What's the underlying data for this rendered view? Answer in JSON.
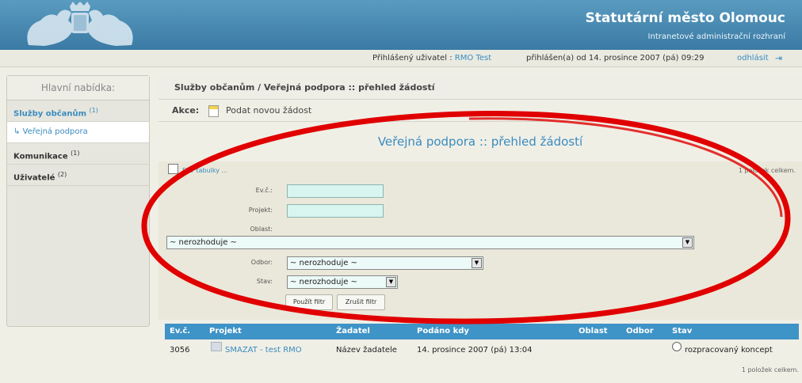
{
  "header": {
    "title": "Statutární město Olomouc",
    "subtitle": "Intranetové administrační rozhraní",
    "logo_icon": "eagle-coat-of-arms-icon"
  },
  "userbar": {
    "logged_label": "Přihlášený uživatel :",
    "user": "RMO Test",
    "since": "přihlášen(a) od 14. prosince 2007 (pá) 09:29",
    "logout": "odhlásit",
    "logout_icon": "logout-icon"
  },
  "sidebar": {
    "heading": "Hlavní nabídka:",
    "items": [
      {
        "label": "Služby občanům",
        "count": "(1)"
      },
      {
        "label": "↳ Veřejná podpora",
        "count": ""
      },
      {
        "label": "Komunikace",
        "count": "(1)"
      },
      {
        "label": "Uživatelé",
        "count": "(2)"
      }
    ]
  },
  "main": {
    "breadcrumb": "Služby občanům / Veřejná podpora :: přehled žádostí",
    "actions_label": "Akce:",
    "action_new": "Podat novou žádost",
    "page_title": "Veřejná podpora :: přehled žádostí"
  },
  "filter": {
    "link": "Filtr tabulky ...",
    "count_top": "1 položek celkem.",
    "ev_label": "Ev.č.:",
    "ev_value": "",
    "projekt_label": "Projekt:",
    "projekt_value": "",
    "oblast_label": "Oblast:",
    "oblast_value": "~ nerozhoduje ~",
    "odbor_label": "Odbor:",
    "odbor_value": "~ nerozhoduje ~",
    "stav_label": "Stav:",
    "stav_value": "~ nerozhoduje ~",
    "apply_button": "Použít filtr",
    "cancel_button": "Zrušit filtr"
  },
  "table": {
    "headers": [
      "Ev.č.",
      "Projekt",
      "Žadatel",
      "Podáno kdy",
      "Oblast",
      "Odbor",
      "Stav"
    ],
    "rows": [
      [
        "3056",
        "SMAZAT - test RMO",
        "Název žadatele",
        "14. prosince 2007 (pá) 13:04",
        "",
        "",
        "rozpracovaný koncept"
      ]
    ],
    "count_bottom": "1 položek celkem."
  },
  "colors": {
    "header_blue": "#4a8db8",
    "link_blue": "#3a8bbf",
    "table_head": "#3e93c7",
    "annotation_red": "#e00000"
  }
}
